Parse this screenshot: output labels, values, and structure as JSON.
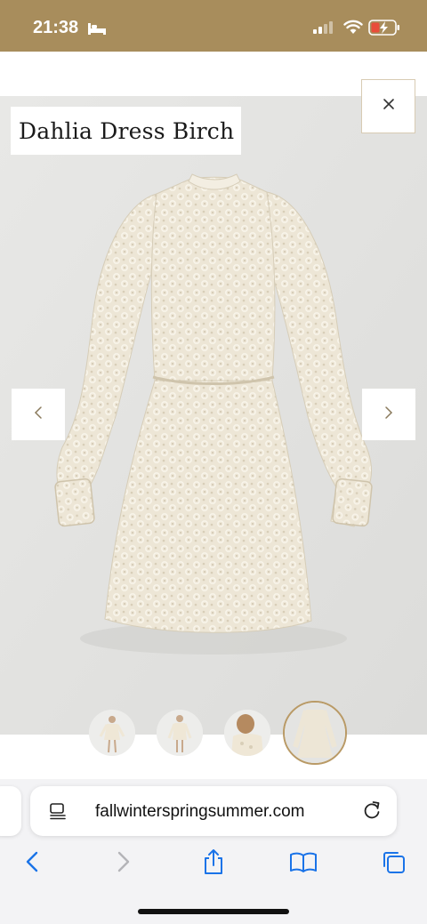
{
  "status_bar": {
    "time": "21:38",
    "icons": [
      "bed-icon",
      "cellular-signal-icon",
      "wifi-icon",
      "battery-charging-icon"
    ],
    "background": "#a88d5c"
  },
  "gallery": {
    "product_title": "Dahlia Dress Birch",
    "close_icon": "close-icon",
    "prev_icon": "chevron-left-icon",
    "next_icon": "chevron-right-icon",
    "thumbnails": [
      {
        "name": "thumbnail-1",
        "selected": false
      },
      {
        "name": "thumbnail-2",
        "selected": false
      },
      {
        "name": "thumbnail-3",
        "selected": false
      },
      {
        "name": "thumbnail-4",
        "selected": true
      }
    ],
    "accent": "#b99a66"
  },
  "browser": {
    "url": "fallwinterspringsummer.com",
    "toolbar": [
      "back-icon",
      "forward-icon",
      "share-icon",
      "bookmarks-icon",
      "tabs-icon"
    ],
    "accent": "#1a73e8"
  }
}
